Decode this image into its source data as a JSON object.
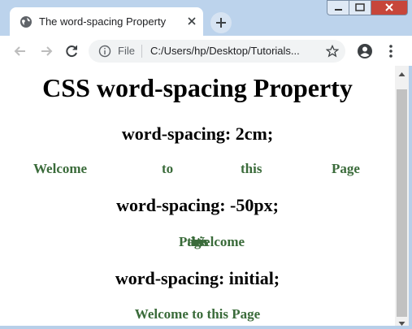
{
  "browser": {
    "tab_title": "The word-spacing Property",
    "scheme": "File",
    "url": "C:/Users/hp/Desktop/Tutorials..."
  },
  "page": {
    "heading": "CSS word-spacing Property",
    "section1": {
      "heading": "word-spacing: 2cm;",
      "words": [
        "Welcome",
        "to",
        "this",
        "Page"
      ]
    },
    "section2": {
      "heading": "word-spacing: -50px;",
      "words": [
        "Welcome",
        "to",
        "this",
        "Page"
      ]
    },
    "section3": {
      "heading": "word-spacing: initial;",
      "text": "Welcome to this Page"
    }
  },
  "colors": {
    "sample_text": "#3a6b3a",
    "tab_strip": "#bcd3ec",
    "close_button": "#c7463a"
  },
  "icons": [
    "globe-icon",
    "close-icon",
    "plus-icon",
    "back-icon",
    "forward-icon",
    "reload-icon",
    "info-icon",
    "star-icon",
    "account-icon",
    "menu-icon"
  ]
}
